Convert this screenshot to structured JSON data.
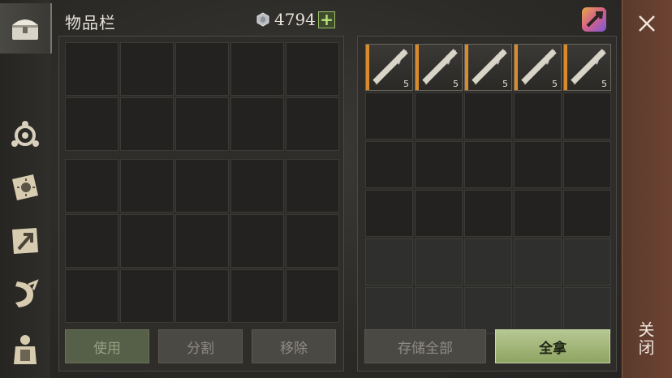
{
  "header": {
    "title": "物品栏",
    "currency_icon": "silver-coin-icon",
    "currency_value": "4794",
    "add_currency_label": "+"
  },
  "sidebar": {
    "tabs": [
      {
        "name": "chest",
        "icon": "chest-icon",
        "active": true
      },
      {
        "name": "stats",
        "icon": "rings-icon",
        "active": false
      },
      {
        "name": "journal",
        "icon": "sun-book-icon",
        "active": false
      },
      {
        "name": "map",
        "icon": "map-arrow-icon",
        "active": false
      },
      {
        "name": "scroll",
        "icon": "scroll-icon",
        "active": false
      },
      {
        "name": "character",
        "icon": "armor-icon",
        "active": false
      }
    ]
  },
  "inventory": {
    "actions": {
      "use_label": "使用",
      "split_label": "分割",
      "remove_label": "移除"
    }
  },
  "storage": {
    "items": [
      {
        "icon": "halberd-icon",
        "count": "5",
        "rarity_color": "#d98a2c"
      },
      {
        "icon": "halberd-icon",
        "count": "5",
        "rarity_color": "#d98a2c"
      },
      {
        "icon": "halberd-icon",
        "count": "5",
        "rarity_color": "#d98a2c"
      },
      {
        "icon": "halberd-icon",
        "count": "5",
        "rarity_color": "#d98a2c"
      },
      {
        "icon": "halberd-icon",
        "count": "5",
        "rarity_color": "#d98a2c"
      }
    ],
    "actions": {
      "store_all_label": "存储全部",
      "take_all_label": "全拿"
    }
  },
  "close": {
    "label": "关闭",
    "icon": "close-icon"
  },
  "colors": {
    "accent_green": "#8ea462",
    "close_bg": "#6d4332",
    "rarity_orange": "#d98a2c"
  }
}
